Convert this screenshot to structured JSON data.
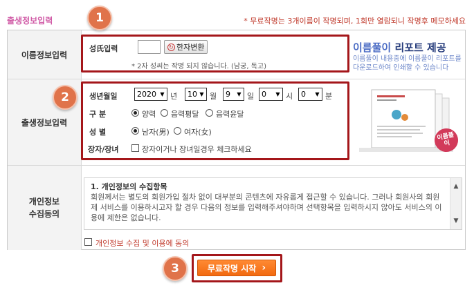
{
  "header": {
    "title": "출생정보입력",
    "note": "* 무료작명는 3개이름이 작명되며, 1회만 열람되니 작명후 메모하세요"
  },
  "badges": [
    "1",
    "2",
    "3"
  ],
  "name_section": {
    "label": "이름정보입력",
    "surname_label": "성氏입력",
    "surname_value": "",
    "hanja_button": "한자변환",
    "hanja_icon": "↻",
    "note": "* 2자 성씨는 작명 되지 않습니다. (남궁, 독고)"
  },
  "birth_section": {
    "label": "출생정보입력",
    "datetime_label": "생년월일",
    "year": "2020",
    "year_unit": "년",
    "month": "10",
    "month_unit": "월",
    "day": "9",
    "day_unit": "일",
    "hour": "0",
    "hour_unit": "시",
    "minute": "0",
    "minute_unit": "분",
    "calendar_label": "구  분",
    "calendar_options": [
      "양력",
      "음력평달",
      "음력윤달"
    ],
    "calendar_selected": 0,
    "gender_label": "성  별",
    "gender_options": [
      "남자(男)",
      "여자(女)"
    ],
    "gender_selected": 0,
    "eldest_label": "장자/장녀",
    "eldest_text": "장자이거나 장녀일경우 체크하세요"
  },
  "ad": {
    "title_a": "이름풀이",
    "title_b": "리포트 제공",
    "sub1": "이름풀이 내용중에 이름풀이 리포트를",
    "sub2": "다운로드하여 인쇄할 수 있습니다",
    "stamp": "이름풀이"
  },
  "consent_section": {
    "label": "개인정보\n수집동의",
    "heading": "1. 개인정보의 수집항목",
    "body": "회원께서는 별도의 회원가입 절차 없이 대부분의 콘텐츠에 자유롭게 접근할 수 있습니다. 그러나 회원사의 회원제 서비스를 이용하시고자 할 경우 다음의 정보를 입력해주셔야하며 선택항목을 입력하시지 않아도 서비스의 이용에 제한은 없습니다.",
    "agree_text": "개인정보 수집 및 이용에 동의"
  },
  "start_button": {
    "label": "무료작명 시작",
    "arrow": "›"
  },
  "colors": {
    "title_pink": "#d05aa6",
    "note_red": "#c0392b",
    "frame_red": "#a4161a",
    "badge": "#e0734a",
    "button_orange": "#f26a10"
  }
}
